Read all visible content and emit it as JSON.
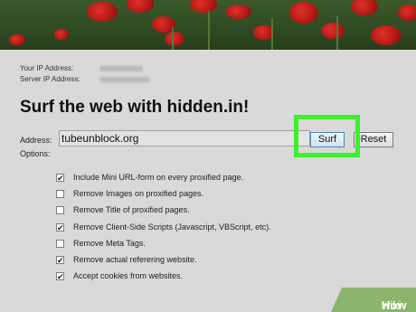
{
  "ip": {
    "your_ip_label": "Your IP Address:",
    "server_ip_label": "Server IP Address:"
  },
  "title": "Surf the web with hidden.in!",
  "address": {
    "label": "Address:",
    "value": "tubeunblock.org"
  },
  "options_label": "Options:",
  "buttons": {
    "surf": "Surf",
    "reset": "Reset"
  },
  "options": [
    {
      "label": "Include Mini URL-form on every proxified page.",
      "checked": true
    },
    {
      "label": "Remove Images on proxified pages.",
      "checked": false
    },
    {
      "label": "Remove Title of proxified pages.",
      "checked": false
    },
    {
      "label": "Remove Client-Side Scripts (Javascript, VBScript, etc).",
      "checked": true
    },
    {
      "label": "Remove Meta Tags.",
      "checked": false
    },
    {
      "label": "Remove actual referering website.",
      "checked": true
    },
    {
      "label": "Accept cookies from websites.",
      "checked": true
    }
  ],
  "watermark": {
    "wiki": "wiki",
    "how": "How"
  },
  "colors": {
    "highlight": "#3cf02a",
    "watermark_bg": "#8bb56c"
  }
}
